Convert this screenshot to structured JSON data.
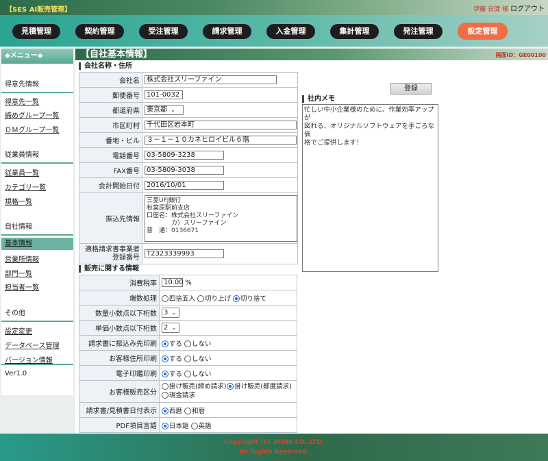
{
  "header": {
    "app_title": "【SES AI販売管理】",
    "user": "伊藤 日健 様",
    "logout": "ログアウト"
  },
  "nav": [
    {
      "label": "見積管理"
    },
    {
      "label": "契約管理"
    },
    {
      "label": "受注管理"
    },
    {
      "label": "請求管理"
    },
    {
      "label": "入金管理"
    },
    {
      "label": "集計管理"
    },
    {
      "label": "発注管理"
    },
    {
      "label": "設定管理"
    }
  ],
  "sidebar": {
    "title": "◆メニュー◆",
    "sections": [
      {
        "title": "得意先情報",
        "items": [
          "得意先一覧",
          "締めグループ一覧",
          "ＤＭグループ一覧"
        ]
      },
      {
        "title": "従業員情報",
        "items": [
          "従業員一覧",
          "カテゴリ一覧",
          "規格一覧"
        ]
      },
      {
        "title": "自社情報",
        "items": [
          "基本情報",
          "営業所情報",
          "部門一覧",
          "担当者一覧"
        ]
      },
      {
        "title": "その他",
        "items": [
          "設定変更",
          "データベース管理",
          "バージョン情報"
        ]
      }
    ],
    "version": "Ver1.0"
  },
  "page": {
    "title": "【自社基本情報】",
    "screen_id": "画面ID：GE00100"
  },
  "company": {
    "section_title": "会社名称・住所",
    "name_label": "会社名",
    "name": "株式会社スリーファイン",
    "zip_label": "郵便番号",
    "zip": "101-0032",
    "pref_label": "都道府県",
    "pref": "東京都",
    "city_label": "市区町村",
    "city": "千代田区岩本町",
    "address_label": "番地・ビル",
    "address": "３－１－１０カネヒロイビル６階",
    "tel_label": "電話番号",
    "tel": "03-5809-3238",
    "fax_label": "FAX番号",
    "fax": "03-5809-3038",
    "fiscal_label": "会計開始日付",
    "fiscal": "2016/10/01",
    "bank_label": "振込先情報",
    "bank": "三菱UFJ銀行\n秋葉原駅前支店\n口座名：株式会社スリーファイン\n　　　　カ）スリーファイン\n普　通：0136671",
    "invoice_label_1": "適格請求書事業者",
    "invoice_label_2": "登録番号",
    "invoice": "T2323339993"
  },
  "sales": {
    "section_title": "販売に関する情報",
    "tax_label": "消費税率",
    "tax": "10.00",
    "tax_unit": "%",
    "rounding_label": "端数処理",
    "rounding_options": [
      {
        "label": "四捨五入",
        "checked": false
      },
      {
        "label": "切り上げ",
        "checked": false
      },
      {
        "label": "切り捨て",
        "checked": true
      }
    ],
    "qty_decimal_label": "数量小数点以下桁数",
    "qty_decimal": "3",
    "price_decimal_label": "単価小数点以下桁数",
    "price_decimal": "2",
    "invoice_print_label": "請求書に振込み先印刷",
    "invoice_print_options": [
      {
        "label": "する",
        "checked": true
      },
      {
        "label": "しない",
        "checked": false
      }
    ],
    "addr_print_label": "お客様住所印刷",
    "addr_print_options": [
      {
        "label": "する",
        "checked": true
      },
      {
        "label": "しない",
        "checked": false
      }
    ],
    "stamp_label": "電子印鑑印刷",
    "stamp_options": [
      {
        "label": "する",
        "checked": true
      },
      {
        "label": "しない",
        "checked": false
      }
    ],
    "sales_type_label": "お客様販売区分",
    "sales_type_options": [
      {
        "label": "掛け販売(締め請求)",
        "checked": false
      },
      {
        "label": "掛け販売(都度請求)",
        "checked": true
      },
      {
        "label": "現金請求",
        "checked": false
      }
    ],
    "date_format_label": "請求書/見積書日付表示",
    "date_format_options": [
      {
        "label": "西暦",
        "checked": true
      },
      {
        "label": "和暦",
        "checked": false
      }
    ],
    "pdf_lang_label": "PDF項目言語",
    "pdf_lang_options": [
      {
        "label": "日本語",
        "checked": true
      },
      {
        "label": "英語",
        "checked": false
      }
    ]
  },
  "memo": {
    "register_label": "登録",
    "title": "社内メモ",
    "text": "忙しい中小企業様のために、作業効率アップが\n図れる、オリジナルソフトウェアを手ごろな価\n格でご提供します！"
  },
  "footer": {
    "copyright": "Copyright (C) 3FINE CO.,LTD.",
    "rights": "All Rights Reserved."
  }
}
